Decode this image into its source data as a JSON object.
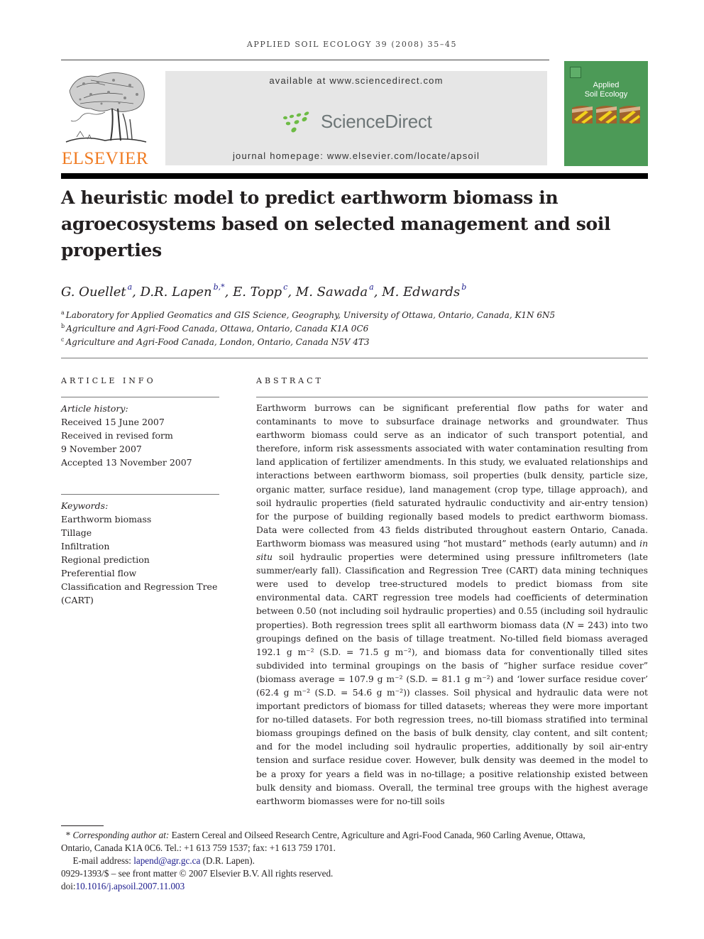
{
  "running_head": "APPLIED SOIL ECOLOGY 39 (2008) 35–45",
  "header": {
    "publisher_logo_text": "ELSEVIER",
    "available_at": "available at www.sciencedirect.com",
    "sciencedirect_logo_text": "ScienceDirect",
    "journal_homepage": "journal homepage: www.elsevier.com/locate/apsoil",
    "cover_title_line1": "Applied",
    "cover_title_line2": "Soil Ecology",
    "colors": {
      "elsevier_orange": "#f07b22",
      "sciencedirect_green": "#6dbb45",
      "cover_green": "#4c9a57",
      "link_blue": "#1a1a8c"
    }
  },
  "title": "A heuristic model to predict earthworm biomass in agroecosystems based on selected management and soil properties",
  "authors": [
    {
      "name": "G. Ouellet",
      "sup": "a",
      "sep": ", "
    },
    {
      "name": "D.R. Lapen",
      "sup": "b,*",
      "sep": ", "
    },
    {
      "name": "E. Topp",
      "sup": "c",
      "sep": ", "
    },
    {
      "name": "M. Sawada",
      "sup": "a",
      "sep": ", "
    },
    {
      "name": "M. Edwards",
      "sup": "b",
      "sep": ""
    }
  ],
  "affiliations": [
    {
      "mark": "a",
      "text": "Laboratory for Applied Geomatics and GIS Science, Geography, University of Ottawa, Ontario, Canada, K1N 6N5"
    },
    {
      "mark": "b",
      "text": "Agriculture and Agri-Food Canada, Ottawa, Ontario, Canada K1A 0C6"
    },
    {
      "mark": "c",
      "text": "Agriculture and Agri-Food Canada, London, Ontario, Canada N5V 4T3"
    }
  ],
  "article_info": {
    "heading": "ARTICLE INFO",
    "history_label": "Article history:",
    "history": [
      "Received 15 June 2007",
      "Received in revised form",
      "9 November 2007",
      "Accepted 13 November 2007"
    ],
    "keywords_label": "Keywords:",
    "keywords": [
      "Earthworm biomass",
      "Tillage",
      "Infiltration",
      "Regional prediction",
      "Preferential flow",
      "Classification and Regression Tree",
      "(CART)"
    ]
  },
  "abstract": {
    "heading": "ABSTRACT",
    "p1": "Earthworm burrows can be significant preferential flow paths for water and contaminants to move to subsurface drainage networks and groundwater. Thus earthworm biomass could serve as an indicator of such transport potential, and therefore, inform risk assessments associated with water contamination resulting from land application of fertilizer amendments. In this study, we evaluated relationships and interactions between earthworm biomass, soil properties (bulk density, particle size, organic matter, surface residue), land management (crop type, tillage approach), and soil hydraulic properties (field saturated hydraulic conductivity and air-entry tension) for the purpose of building regionally based models to predict earthworm biomass. Data were collected from 43 fields distributed throughout eastern Ontario, Canada. Earthworm biomass was measured using “hot mustard” methods (early autumn) and ",
    "p1_italic": "in situ",
    "p2": " soil hydraulic properties were determined using pressure infiltrometers (late summer/early fall). Classification and Regression Tree (CART) data mining techniques were used to develop tree-structured models to predict biomass from site environmental data. CART regression tree models had coefficients of determination between 0.50 (not including soil hydraulic properties) and 0.55 (including soil hydraulic properties). Both regression trees split all earthworm biomass data (",
    "p2_italic": "N",
    "p3": " = 243) into two groupings defined on the basis of tillage treatment. No-tilled field biomass averaged 192.1 g m⁻² (S.D. = 71.5 g m⁻²), and biomass data for conventionally tilled sites subdivided into terminal groupings on the basis of “higher surface residue cover” (biomass average = 107.9 g m⁻² (S.D. = 81.1 g m⁻²) and ‘lower surface residue cover’ (62.4 g m⁻² (S.D. = 54.6 g m⁻²)) classes. Soil physical and hydraulic data were not important predictors of biomass for tilled datasets; whereas they were more important for no-tilled datasets. For both regression trees, no-till biomass stratified into terminal biomass groupings defined on the basis of bulk density, clay content, and silt content; and for the model including soil hydraulic properties, additionally by soil air-entry tension and surface residue cover. However, bulk density was deemed in the model to be a proxy for years a field was in no-tillage; a positive relationship existed between bulk density and biomass. Overall, the terminal tree groups with the highest average earthworm biomasses were for no-till soils"
  },
  "footnotes": {
    "corr_mark": "*",
    "corr_label": "Corresponding author at:",
    "corr_text_line1": " Eastern Cereal and Oilseed Research Centre, Agriculture and Agri-Food Canada, 960 Carling Avenue, Ottawa,",
    "corr_text_line2": "Ontario, Canada K1A 0C6. Tel.: +1 613 759 1537; fax: +1 613 759 1701.",
    "email_label": "E-mail address: ",
    "email": "lapend@agr.gc.ca",
    "email_suffix": " (D.R. Lapen).",
    "issn_line": "0929-1393/$ – see front matter © 2007 Elsevier B.V. All rights reserved.",
    "doi_label": "doi:",
    "doi": "10.1016/j.apsoil.2007.11.003"
  }
}
